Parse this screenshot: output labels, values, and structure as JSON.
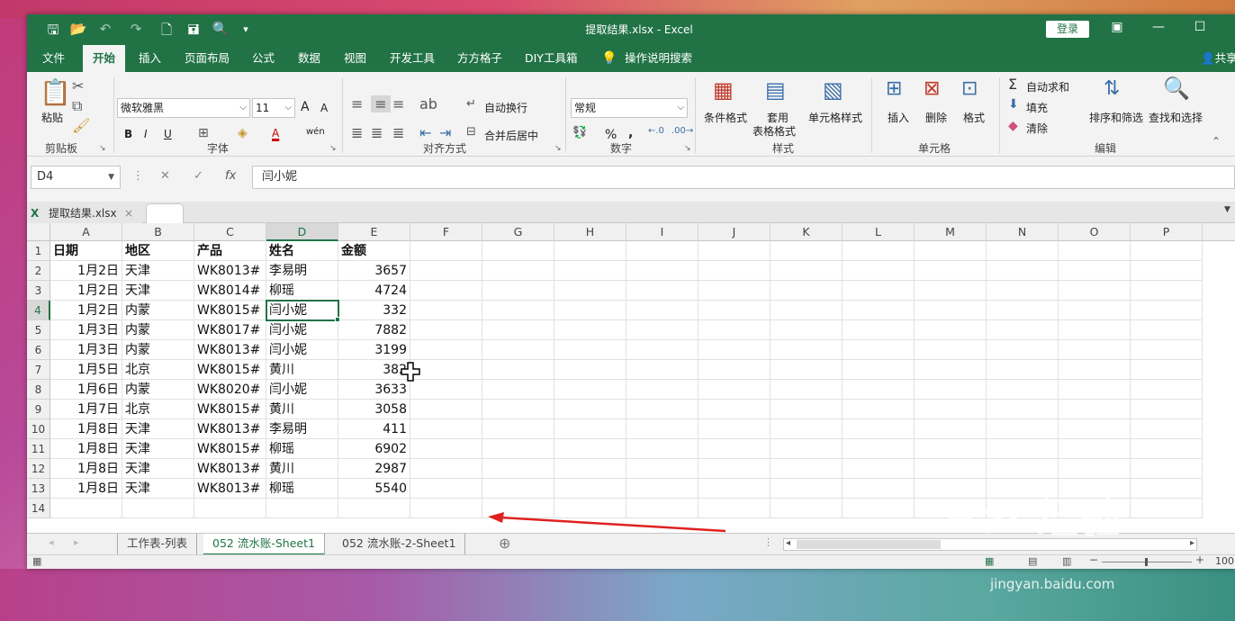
{
  "window": {
    "title": "提取结果.xlsx  -  Excel",
    "login": "登录",
    "share": "共享"
  },
  "menu": [
    "文件",
    "开始",
    "插入",
    "页面布局",
    "公式",
    "数据",
    "视图",
    "开发工具",
    "方方格子",
    "DIY工具箱",
    "操作说明搜索"
  ],
  "ribbon": {
    "clipboard": {
      "paste": "粘贴",
      "label": "剪贴板"
    },
    "font": {
      "name": "微软雅黑",
      "size": "11",
      "bold": "B",
      "italic": "I",
      "underline": "U",
      "grow": "A",
      "shrink": "A",
      "fontcolor": "A",
      "wen": "wén",
      "label": "字体"
    },
    "align": {
      "wrap": "自动换行",
      "merge": "合并后居中",
      "label": "对齐方式"
    },
    "number": {
      "format": "常规",
      "percent": "%",
      "comma": ",",
      "label": "数字"
    },
    "styles": {
      "cond": "条件格式",
      "table_line1": "套用",
      "table_line2": "表格格式",
      "cell": "单元格样式",
      "label": "样式"
    },
    "cells": {
      "insert": "插入",
      "delete": "删除",
      "format": "格式",
      "label": "单元格"
    },
    "editing": {
      "autosum": "自动求和",
      "fill": "填充",
      "clear": "清除",
      "sort": "排序和筛选",
      "find": "查找和选择",
      "label": "编辑"
    }
  },
  "formula": {
    "namebox": "D4",
    "fx": "fx",
    "value": "闫小妮"
  },
  "doc_tab": "提取结果.xlsx",
  "columns": [
    "A",
    "B",
    "C",
    "D",
    "E",
    "F",
    "G",
    "H",
    "I",
    "J",
    "K",
    "L",
    "M",
    "N",
    "O",
    "P"
  ],
  "rows": [
    [
      "日期",
      "地区",
      "产品",
      "姓名",
      "金额"
    ],
    [
      "1月2日",
      "天津",
      "WK8013#",
      "李易明",
      "3657"
    ],
    [
      "1月2日",
      "天津",
      "WK8014#",
      "柳瑶",
      "4724"
    ],
    [
      "1月2日",
      "内蒙",
      "WK8015#",
      "闫小妮",
      "332"
    ],
    [
      "1月3日",
      "内蒙",
      "WK8017#",
      "闫小妮",
      "7882"
    ],
    [
      "1月3日",
      "内蒙",
      "WK8013#",
      "闫小妮",
      "3199"
    ],
    [
      "1月5日",
      "北京",
      "WK8015#",
      "黄川",
      "382"
    ],
    [
      "1月6日",
      "内蒙",
      "WK8020#",
      "闫小妮",
      "3633"
    ],
    [
      "1月7日",
      "北京",
      "WK8015#",
      "黄川",
      "3058"
    ],
    [
      "1月8日",
      "天津",
      "WK8013#",
      "李易明",
      "411"
    ],
    [
      "1月8日",
      "天津",
      "WK8015#",
      "柳瑶",
      "6902"
    ],
    [
      "1月8日",
      "天津",
      "WK8013#",
      "黄川",
      "2987"
    ],
    [
      "1月8日",
      "天津",
      "WK8013#",
      "柳瑶",
      "5540"
    ],
    [
      "",
      "",
      "",
      "",
      ""
    ]
  ],
  "sheets": [
    "工作表-列表",
    "052 流水账-Sheet1",
    "052 流水账-2-Sheet1"
  ],
  "active_sheet": "052 流水账-Sheet1",
  "zoom": "100",
  "watermark": {
    "main": "Bai 经验",
    "url": "jingyan.baidu.com"
  },
  "colors": {
    "excel_green": "#217346",
    "arrow_red": "#e02020"
  }
}
